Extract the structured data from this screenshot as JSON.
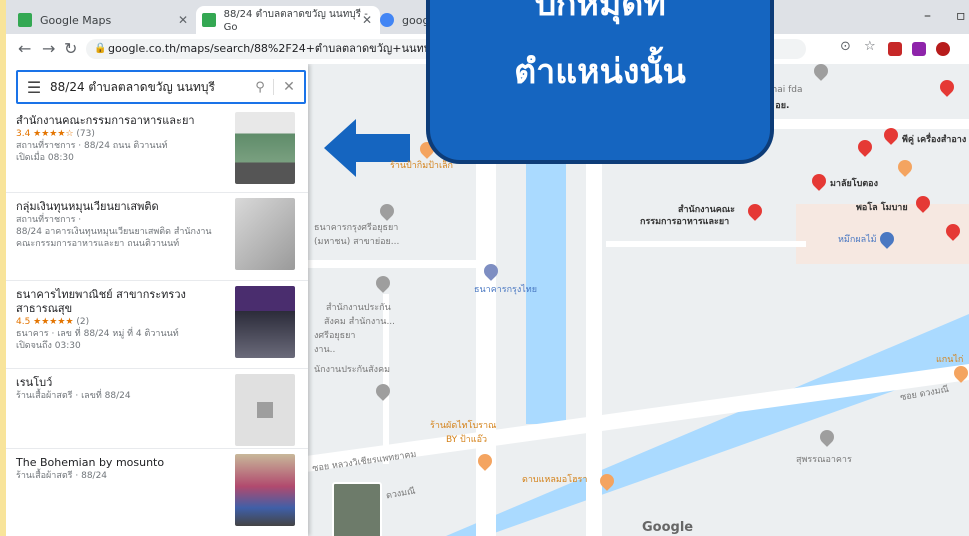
{
  "tabs": [
    {
      "label": "Google Maps",
      "favicon_color": "#34a853"
    },
    {
      "label": "88/24 ตำบลตลาดขวัญ นนทบุรี - Go",
      "favicon_color": "#34a853"
    },
    {
      "label": "google m",
      "favicon_color": "#4285f4"
    }
  ],
  "address_bar": {
    "url": "google.co.th/maps/search/88%2F24+ตำบลตลาดขวัญ+นนทบุรี/@13.846"
  },
  "search": {
    "query": "88/24 ตำบลตลาดขวัญ นนทบุรี"
  },
  "callout": {
    "line1": "ปักหมุดที่",
    "line2": "ตำแหน่งนั้น"
  },
  "results": [
    {
      "name": "สำนักงานคณะกรรมการอาหารและยา",
      "rating": "3.4 ★★★★☆",
      "count": "(73)",
      "desc1": "สถานที่ราชการ · 88/24 ถนน ติวานนท์",
      "desc2": "เปิดเมื่อ 08:30"
    },
    {
      "name": "กลุ่มเงินทุนหมุนเวียนยาเสพติด",
      "desc1": "สถานที่ราชการ ·",
      "desc2": "88/24 อาคารเงินทุนหมุนเวียนยาเสพติด สำนักงาน",
      "desc3": "คณะกรรมการอาหารและยา ถนนติวานนท์"
    },
    {
      "name": "ธนาคารไทยพาณิชย์ สาขากระทรวง",
      "name2": "สาธารณสุข",
      "rating": "4.5 ★★★★★",
      "count": "(2)",
      "desc1": "ธนาคาร · เลข ที่ 88/24 หมู่ ที่ 4 ติวานนท์",
      "desc2": "เปิดจนถึง 03:30"
    },
    {
      "name": "เรนโบว์",
      "desc1": "ร้านเสื้อผ้าสตรี · เลขที่ 88/24"
    },
    {
      "name": "The Bohemian by mosunto",
      "desc1": "ร้านเสื้อผ้าสตรี · 88/24"
    }
  ],
  "map_labels": {
    "thai_fda": "Thai fda",
    "nom": "น อย.",
    "piku": "พีคู่ เครื่องสำอาง",
    "malai": "มาลัยโบตอง",
    "polo": "พอโล โมบาย",
    "fda_office_1": "สำนักงานคณะ",
    "fda_office_2": "กรรมการอาหารและยา",
    "mak": "หมึกผลไม้",
    "shop1": "ร้านป้ากิมป้าเล็ก",
    "bank1": "ธนาคารกรุงศรีอยุธยา",
    "bank1b": "(มหาชน) สาขาย่อย...",
    "bank2": "ธนาคารกรุงไทย",
    "ins1": "สำนักงานประกัน",
    "ins2": "สังคม สำนักงาน...",
    "ins3": "งศรีอยุธยา",
    "ins4": "งาน..",
    "ins5": "นักงานประกันสังคม",
    "shop2a": "ร้านผัดไทโบราณ",
    "shop2b": "BY ป้าแอ๊ว",
    "road1": "ซอย หลวงวิเชียรแพทยาคม",
    "road2": "ซอย ดวงมณี",
    "school": "สุพรรณอาคาร",
    "lab": "ดาบแหลมอโฮรา",
    "maeng": "แกนไก่",
    "dongmani": "ดวงมณี",
    "google": "Google"
  }
}
